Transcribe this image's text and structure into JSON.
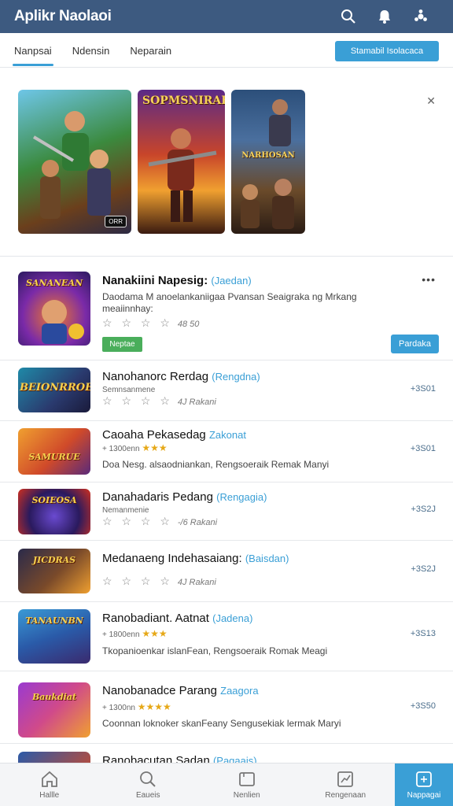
{
  "app": {
    "title": "Aplikr Naolaoi"
  },
  "tabs": [
    {
      "label": "Nanpsai",
      "active": true
    },
    {
      "label": "Ndensin",
      "active": false
    },
    {
      "label": "Neparain",
      "active": false
    }
  ],
  "tab_button": "Stamabil Isolacaca",
  "featured": [
    {
      "title": "",
      "subtitle": "",
      "badge": "ORR"
    },
    {
      "title": "SOPMSNIRAE",
      "subtitle": "",
      "badge": ""
    },
    {
      "title": "",
      "subtitle": "NARHOSAN",
      "badge": ""
    }
  ],
  "items": [
    {
      "thumb_label": "SANANEAN",
      "name": "Nanakiini Napesig:",
      "category": "(Jaedan)",
      "desc": "Daodama M anoelankaniigaa Pvansan Seaigraka ng Mrkang meaiinnhay:",
      "stars": "☆ ☆ ☆ ☆",
      "count": "48 50",
      "tag": "Neptae",
      "action": "Pardaka",
      "menu": "•••"
    },
    {
      "thumb_label": "BEIONRROE",
      "name": "Nanohanorc Rerdag",
      "category": "(Rengdna)",
      "meta": "Semnsanmene",
      "stars": "☆ ☆ ☆ ☆",
      "count": "4J Rakani",
      "action": "+3S01"
    },
    {
      "thumb_label": "SAMURUE",
      "name": "Caoaha Pekasedag",
      "category": "Zakonat",
      "meta": "+ 1300enn",
      "meta_stars": "★★★",
      "desc": "Doa Nesg. alsaodniankan, Rengsoeraik Remak Manyi",
      "action": "+3S01"
    },
    {
      "thumb_label": "SOIEOSA",
      "name": "Danahadaris Pedang",
      "category": "(Rengagia)",
      "meta": "Nemanmenie",
      "stars": "☆ ☆ ☆ ☆",
      "count": "-/6 Rakani",
      "action": "+3S2J"
    },
    {
      "thumb_label": "JICDRAS",
      "name": "Medanaeng Indehasaiang:",
      "category": "(Baisdan)",
      "stars": "☆ ☆ ☆ ☆",
      "count": "4J Rakani",
      "action": "+3S2J"
    },
    {
      "thumb_label": "TANAUNBN",
      "name": "Ranobadiant. Aatnat",
      "category": "(Jadena)",
      "meta": "+ 1800enn",
      "meta_stars": "★★★",
      "desc": "Tkopanioenkar islanFean, Rengsoeraik Romak Meagi",
      "action": "+3S13"
    },
    {
      "thumb_label": "Baukdiat",
      "name": "Nanobanadce Parang",
      "category": "Zaagora",
      "meta": "+ 1300nn",
      "meta_stars": "★★★★",
      "desc": "Coonnan loknoker skanFeany Sengusekiak lermak Maryi",
      "action": "+3S50"
    },
    {
      "thumb_label": "",
      "name": "Ranobacutan Sadan",
      "category": "(Pagaais)"
    }
  ],
  "nav": [
    {
      "label": "Hallle",
      "icon": "home-icon"
    },
    {
      "label": "Eaueis",
      "icon": "search-icon"
    },
    {
      "label": "Nenlien",
      "icon": "folder-icon"
    },
    {
      "label": "Rengenaan",
      "icon": "chart-icon"
    },
    {
      "label": "Nappagai",
      "icon": "apps-icon",
      "active": true
    }
  ],
  "colors": {
    "header": "#3d5a80",
    "accent": "#3a9fd6",
    "green": "#4aae5b",
    "star": "#e6a817"
  }
}
